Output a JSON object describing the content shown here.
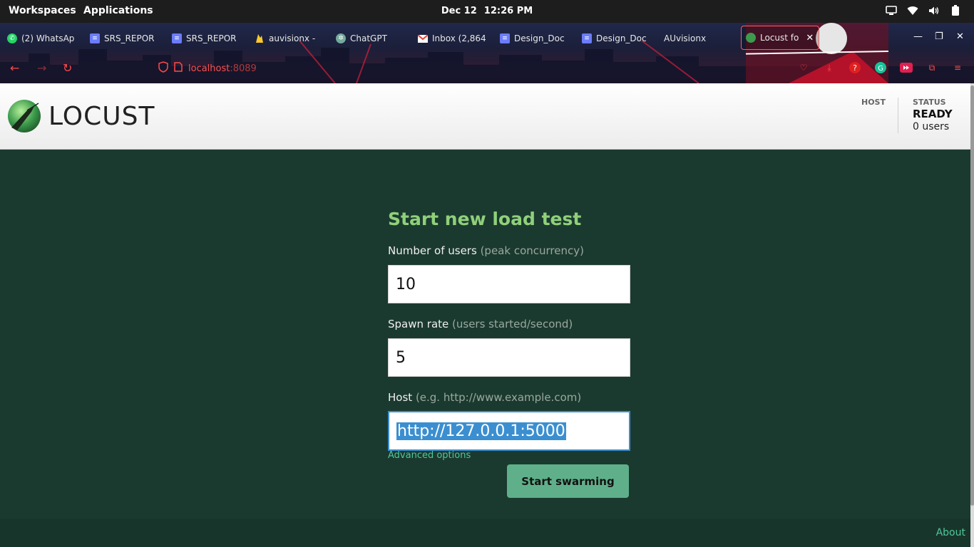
{
  "os_bar": {
    "workspaces": "Workspaces",
    "applications": "Applications",
    "date": "Dec 12",
    "time": "12:26 PM",
    "tray_icons": [
      "display-icon",
      "wifi-icon",
      "volume-icon",
      "battery-icon"
    ]
  },
  "browser": {
    "tabs": [
      {
        "label": "(2) WhatsAp",
        "icon": "whatsapp-icon",
        "icon_color": "#25d366"
      },
      {
        "label": "SRS_REPOR",
        "icon": "docs-icon",
        "icon_color": "#6b7cff"
      },
      {
        "label": "SRS_REPOR",
        "icon": "docs-icon",
        "icon_color": "#6b7cff"
      },
      {
        "label": "auvisionx -",
        "icon": "firebase-icon",
        "icon_color": "#ffca28"
      },
      {
        "label": "ChatGPT",
        "icon": "chatgpt-icon",
        "icon_color": "#74aa9c"
      },
      {
        "label": "Inbox (2,864",
        "icon": "gmail-icon",
        "icon_color": "#ea4335"
      },
      {
        "label": "Design_Doc",
        "icon": "docs-icon",
        "icon_color": "#6b7cff"
      },
      {
        "label": "Design_Doc",
        "icon": "docs-icon",
        "icon_color": "#6b7cff"
      },
      {
        "label": "AUvisionx",
        "icon": "",
        "icon_color": ""
      },
      {
        "label": "Locust fo",
        "icon": "locust-icon",
        "icon_color": "#3c9a4c",
        "active": true
      }
    ],
    "url_host": "localhost",
    "url_port": ":8089",
    "accent": "#ff4a4a"
  },
  "locust": {
    "logo_text": "LOCUST",
    "host_label": "HOST",
    "status_label": "STATUS",
    "status_value": "READY",
    "users_text": "0 users"
  },
  "form": {
    "title": "Start new load test",
    "users_label": "Number of users",
    "users_hint": "(peak concurrency)",
    "users_value": "10",
    "spawn_label": "Spawn rate",
    "spawn_hint": "(users started/second)",
    "spawn_value": "5",
    "host_label": "Host",
    "host_hint": "(e.g. http://www.example.com)",
    "host_value": "http://127.0.0.1:5000",
    "advanced": "Advanced options",
    "start_button": "Start swarming"
  },
  "footer": {
    "about": "About"
  },
  "colors": {
    "page_bg": "#1b3a2f",
    "title_green": "#8fd07a",
    "link_green": "#4ec79a",
    "button_green": "#5fb08a",
    "selection_blue": "#3b8fd0"
  }
}
